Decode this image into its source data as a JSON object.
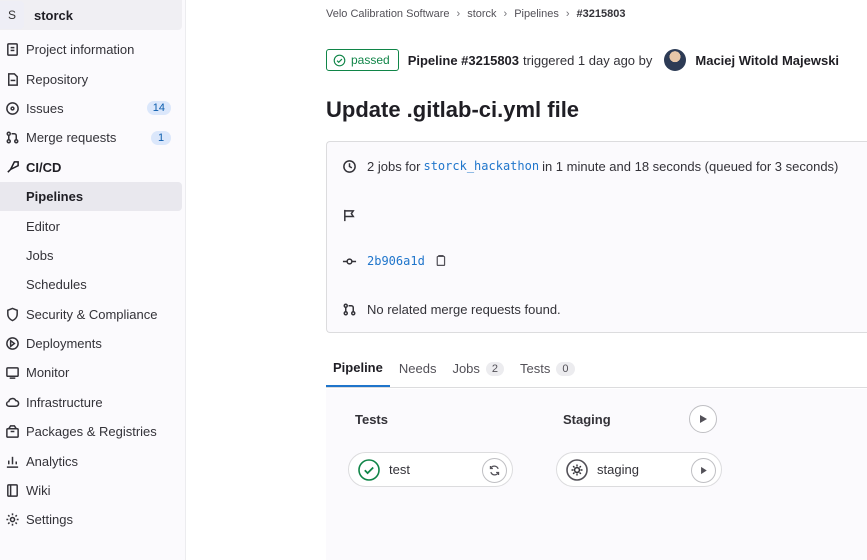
{
  "sidebar": {
    "project_avatar": "S",
    "project_name": "storck",
    "items": [
      {
        "label": "Project information",
        "icon": "info-icon"
      },
      {
        "label": "Repository",
        "icon": "document-icon"
      },
      {
        "label": "Issues",
        "icon": "issues-icon",
        "badge": "14"
      },
      {
        "label": "Merge requests",
        "icon": "merge-request-icon",
        "badge": "1"
      },
      {
        "label": "CI/CD",
        "icon": "rocket-icon"
      },
      {
        "label": "Security & Compliance",
        "icon": "shield-icon"
      },
      {
        "label": "Deployments",
        "icon": "deployments-icon"
      },
      {
        "label": "Monitor",
        "icon": "monitor-icon"
      },
      {
        "label": "Infrastructure",
        "icon": "cloud-icon"
      },
      {
        "label": "Packages & Registries",
        "icon": "package-icon"
      },
      {
        "label": "Analytics",
        "icon": "chart-icon"
      },
      {
        "label": "Wiki",
        "icon": "book-icon"
      },
      {
        "label": "Settings",
        "icon": "gear-icon"
      }
    ],
    "cicd_sub": [
      "Pipelines",
      "Editor",
      "Jobs",
      "Schedules"
    ]
  },
  "breadcrumb": [
    "Velo Calibration Software",
    "storck",
    "Pipelines",
    "#3215803"
  ],
  "header": {
    "status": "passed",
    "pipeline": "Pipeline #3215803",
    "triggered": "triggered 1 day ago by",
    "author": "Maciej Witold Majewski"
  },
  "commit_title": "Update .gitlab-ci.yml file",
  "info": {
    "jobs_prefix": "2 jobs for",
    "branch": "storck_hackathon",
    "jobs_suffix": "in 1 minute and 18 seconds (queued for 3 seconds)",
    "commit_sha": "2b906a1d",
    "mr_text": "No related merge requests found."
  },
  "tabs": [
    {
      "label": "Pipeline"
    },
    {
      "label": "Needs"
    },
    {
      "label": "Jobs",
      "count": "2"
    },
    {
      "label": "Tests",
      "count": "0"
    }
  ],
  "stages": [
    {
      "name": "Tests",
      "job": "test",
      "job_status": "success",
      "job_action": "retry-icon"
    },
    {
      "name": "Staging",
      "job": "staging",
      "job_status": "manual",
      "job_action": "play-icon"
    }
  ],
  "colors": {
    "success": "#108548",
    "link": "#1f75cb",
    "active_tab": "#1f75cb"
  }
}
